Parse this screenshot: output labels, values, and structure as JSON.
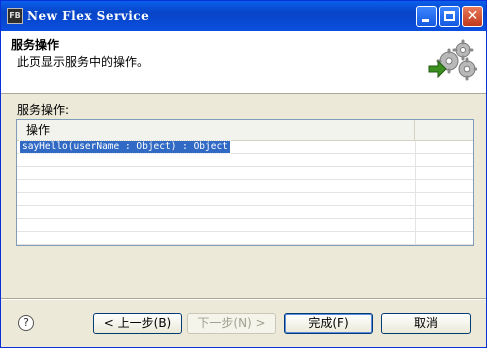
{
  "window": {
    "title": "New Flex Service",
    "app_icon_text": "FB"
  },
  "header": {
    "title": "服务操作",
    "description": "此页显示服务中的操作。"
  },
  "operations": {
    "label": "服务操作:",
    "column_header": "操作",
    "rows": [
      "sayHello(userName : Object) : Object",
      "",
      "",
      "",
      "",
      "",
      "",
      ""
    ],
    "selected_index": 0
  },
  "footer": {
    "help_icon": "?",
    "back_label": "< 上一步(B)",
    "next_label": "下一步(N) >",
    "finish_label": "完成(F)",
    "cancel_label": "取消"
  },
  "colors": {
    "titlebar": "#0a5fea",
    "selection": "#316ac5",
    "dialog_bg": "#ece9d8",
    "arrow_green": "#3a8f1f"
  }
}
